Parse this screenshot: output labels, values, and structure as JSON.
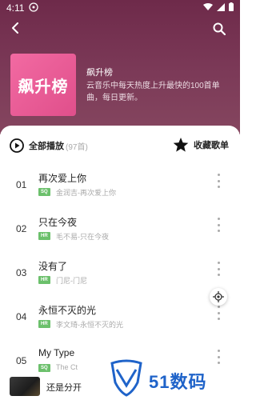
{
  "status_bar": {
    "time": "4:11"
  },
  "playlist": {
    "cover_text": "飙升榜",
    "title": "飙升榜",
    "description": "云音乐中每天热度上升最快的100首单曲，每日更新。"
  },
  "actions": {
    "play_all_label": "全部播放",
    "play_all_count": "(97首)",
    "collect_label": "收藏歌单"
  },
  "songs": [
    {
      "index": "01",
      "name": "再次爱上你",
      "tag": "SQ",
      "meta": "金润吉-再次爱上你"
    },
    {
      "index": "02",
      "name": "只在今夜",
      "tag": "HR",
      "meta": "毛不易-只在今夜"
    },
    {
      "index": "03",
      "name": "没有了",
      "tag": "HR",
      "meta": "门尼-门尼"
    },
    {
      "index": "04",
      "name": "永恒不灭的光",
      "tag": "HR",
      "meta": "李文琦-永恒不灭的光"
    },
    {
      "index": "05",
      "name": "My Type",
      "tag": "SQ",
      "meta": "The Ct"
    }
  ],
  "mini_player": {
    "title": "还是分开"
  },
  "watermark": {
    "text": "51数码"
  },
  "colors": {
    "hero": "#7c3a58",
    "cover": "#e95a94",
    "tag": "#6cc06c",
    "watermark": "#1f63c9"
  }
}
